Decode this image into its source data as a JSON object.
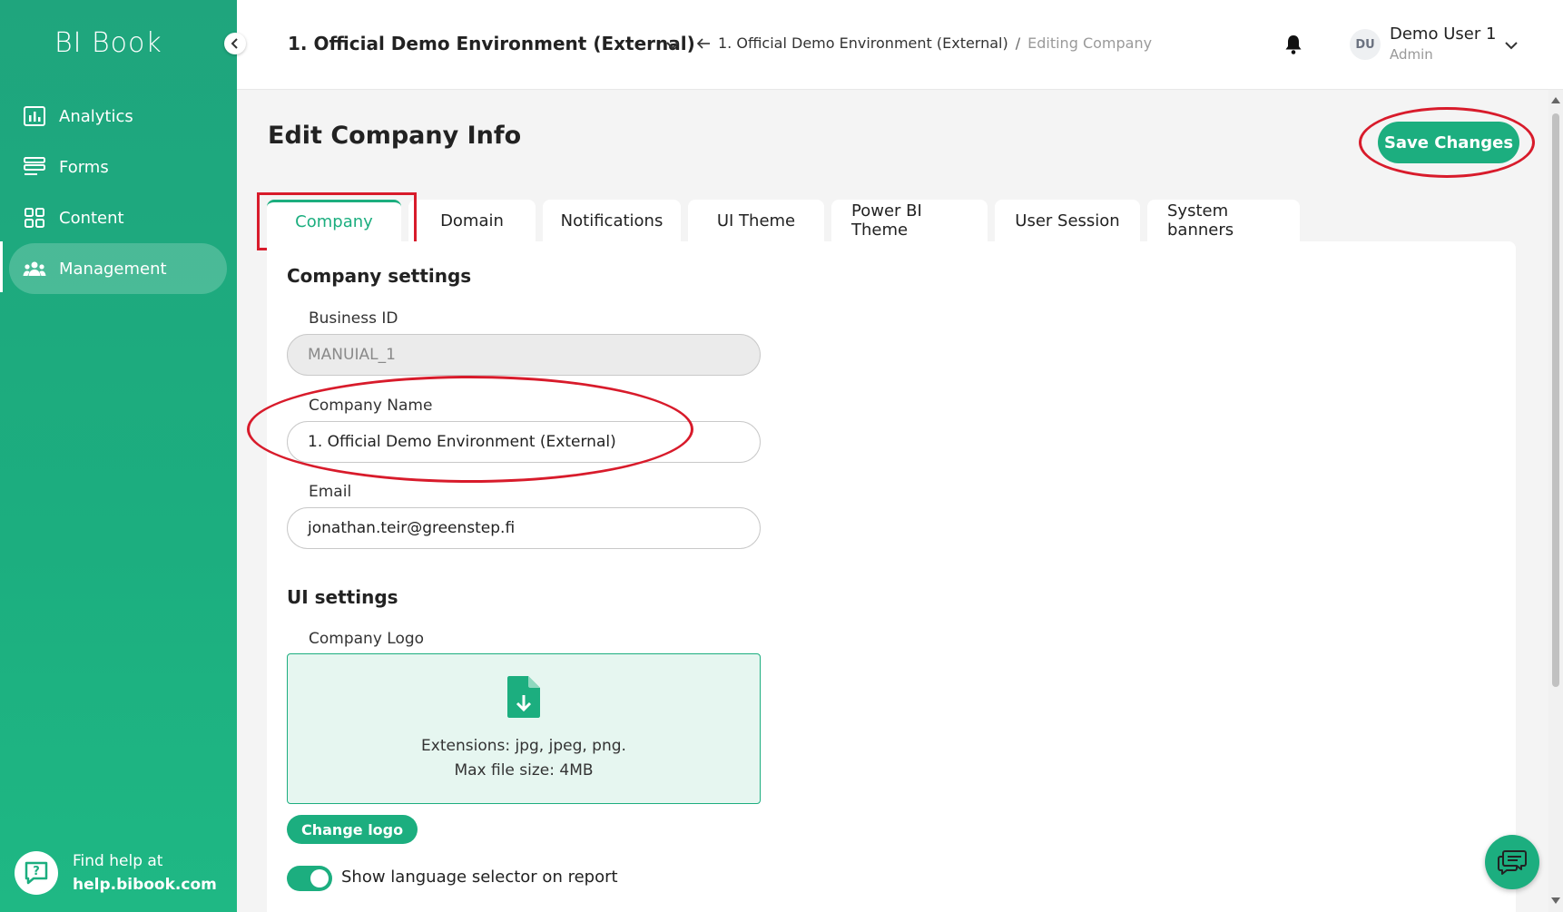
{
  "app": {
    "brand": "BI Book"
  },
  "sidebar": {
    "items": [
      {
        "label": "Analytics",
        "icon": "chart-icon"
      },
      {
        "label": "Forms",
        "icon": "forms-icon"
      },
      {
        "label": "Content",
        "icon": "grid-icon"
      },
      {
        "label": "Management",
        "icon": "users-icon",
        "active": true
      }
    ],
    "help": {
      "line1": "Find help at",
      "link": "help.bibook.com"
    }
  },
  "header": {
    "environment": "1. Official Demo Environment (External)",
    "breadcrumb": {
      "parent": "1. Official Demo Environment (External)",
      "separator": "/",
      "current": "Editing Company"
    },
    "user": {
      "initials": "DU",
      "name": "Demo User 1",
      "role": "Admin"
    }
  },
  "page": {
    "title": "Edit Company Info",
    "save_label": "Save Changes"
  },
  "tabs": [
    {
      "label": "Company",
      "active": true
    },
    {
      "label": "Domain"
    },
    {
      "label": "Notifications"
    },
    {
      "label": "UI Theme"
    },
    {
      "label": "Power BI Theme"
    },
    {
      "label": "User Session"
    },
    {
      "label": "System banners"
    }
  ],
  "company_settings": {
    "title": "Company settings",
    "business_id": {
      "label": "Business ID",
      "value": "MANUIAL_1"
    },
    "company_name": {
      "label": "Company Name",
      "value": "1. Official Demo Environment (External)"
    },
    "email": {
      "label": "Email",
      "value": "jonathan.teir@greenstep.fi"
    }
  },
  "ui_settings": {
    "title": "UI settings",
    "logo_label": "Company Logo",
    "extensions": "Extensions: jpg, jpeg, png.",
    "max_size": "Max file size: 4MB",
    "change_logo_label": "Change logo",
    "language_selector_label": "Show language selector on report",
    "language_selector_on": true
  },
  "colors": {
    "accent": "#1cae7f",
    "annotation": "#d81b2b"
  }
}
